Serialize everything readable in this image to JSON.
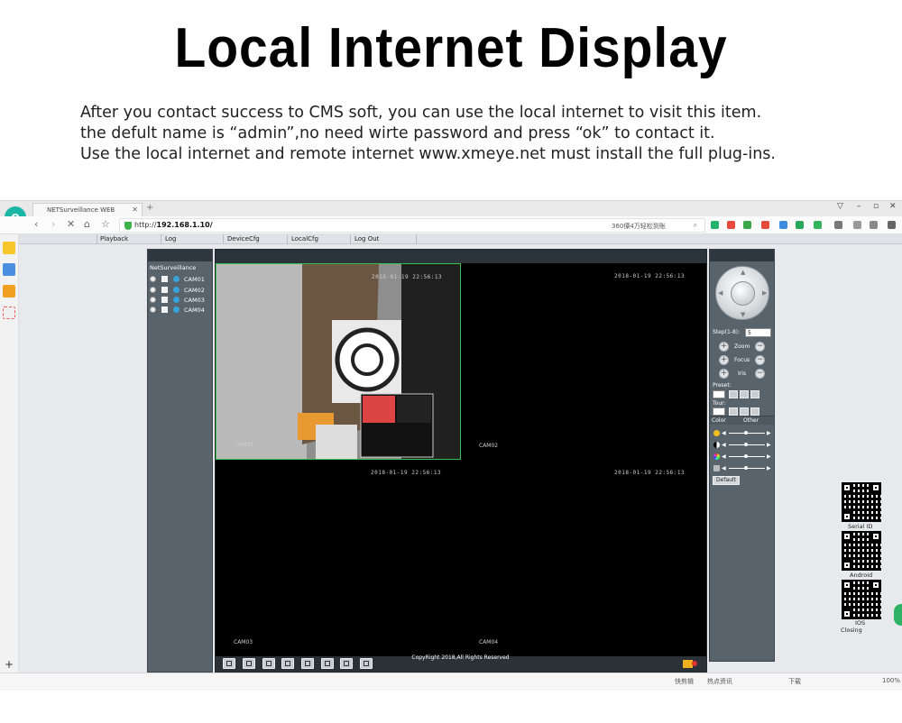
{
  "header": {
    "title": "Local Internet Display",
    "lines": [
      "After you contact success  to CMS soft, you can use the local internet to visit this item.",
      "the defult name is “admin”,no need wirte password and press “ok” to contact it.",
      "Use the local internet and remote internet www.xmeye.net must install the full plug-ins."
    ]
  },
  "browser": {
    "tab_title": "NETSurveillance WEB",
    "url_prefix": "http://",
    "url_host": "192.168.1.10/",
    "search_placeholder": "360僳4万轻松到账",
    "status_items": [
      "快剪辑",
      "热点资讯",
      "下载",
      "100%"
    ]
  },
  "app": {
    "menu": [
      "Playback",
      "Log",
      "DeviceCfg",
      "LocalCfg",
      "Log Out"
    ],
    "device_tree_title": "NetSurveillance",
    "cameras": [
      "CAM01",
      "CAM02",
      "CAM03",
      "CAM04"
    ],
    "timestamps": [
      "2018-01-19 22:56:13",
      "2018-01-19 22:56:13",
      "2018-01-19 22:56:13",
      "2018-01-19 22:56:13"
    ],
    "copyright": "CopyRight 2018,All Rights Reserved",
    "ptz": {
      "step_label": "Step(1-8):",
      "step_value": "5",
      "zoom": "Zoom",
      "focus": "Focus",
      "iris": "Iris",
      "preset": "Preset:",
      "tour": "Tour:",
      "color_tab": "Color",
      "other_tab": "Other",
      "default_btn": "Default"
    }
  },
  "qr_labels": [
    "Serial ID",
    "Android",
    "IOS",
    "Closing"
  ],
  "colors": {
    "accent_green": "#3bbf4e",
    "panel": "#59636c",
    "browser_logo": "#1cb6a6"
  }
}
